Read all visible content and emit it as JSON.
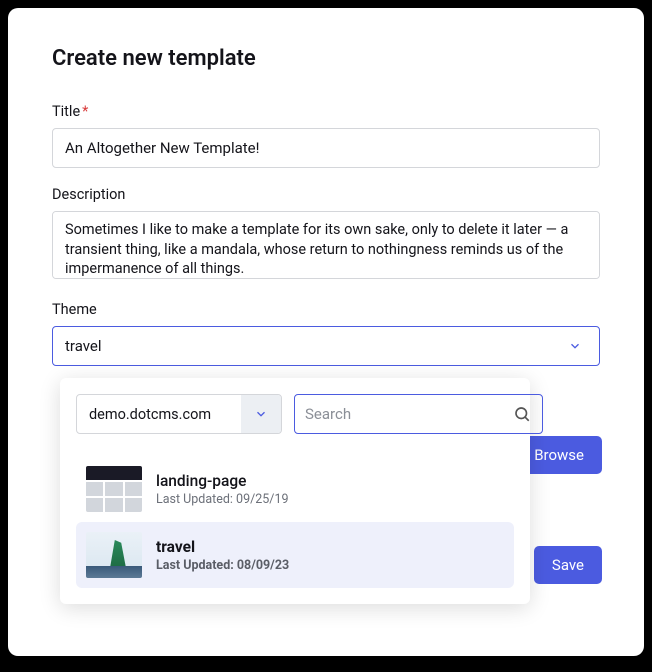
{
  "dialog": {
    "title": "Create new template"
  },
  "fields": {
    "title": {
      "label": "Title",
      "required_mark": "*",
      "value": "An Altogether New Template!"
    },
    "description": {
      "label": "Description",
      "value": "Sometimes I like to make a template for its own sake, only to delete it later — a transient thing, like a mandala, whose return to nothingness reminds us of the impermanence of all things."
    },
    "theme": {
      "label": "Theme",
      "selected": "travel"
    }
  },
  "dropdown": {
    "site_selector": "demo.dotcms.com",
    "search_placeholder": "Search",
    "items": [
      {
        "name": "landing-page",
        "updated": "Last Updated: 09/25/19",
        "selected": false
      },
      {
        "name": "travel",
        "updated": "Last Updated: 08/09/23",
        "selected": true
      }
    ]
  },
  "buttons": {
    "browse": "Browse",
    "save": "Save"
  }
}
